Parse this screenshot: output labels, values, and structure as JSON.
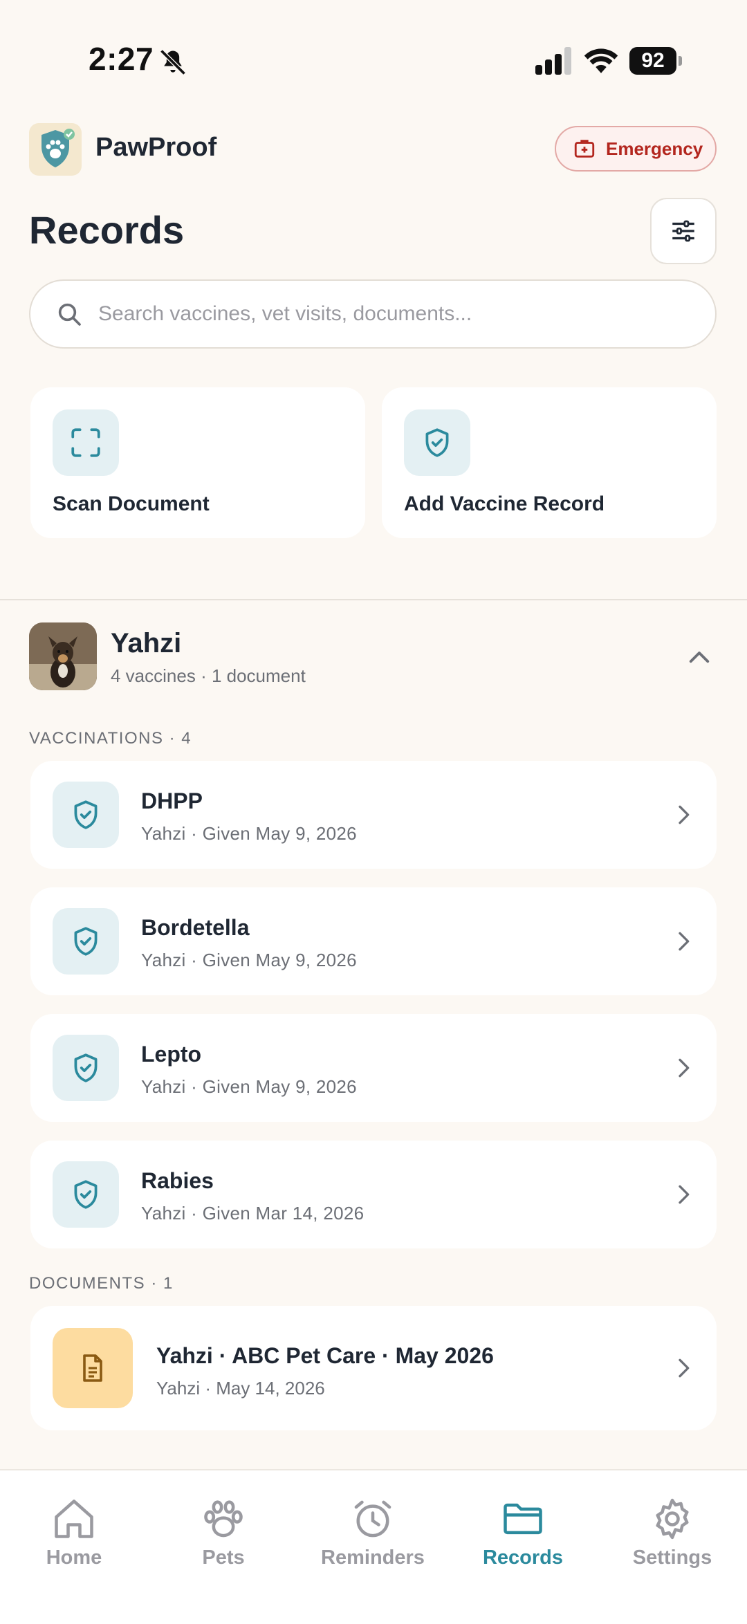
{
  "status_bar": {
    "time": "2:27",
    "battery": "92"
  },
  "header": {
    "app_name": "PawProof",
    "emergency_label": "Emergency",
    "page_title": "Records"
  },
  "search": {
    "placeholder": "Search vaccines, vet visits, documents..."
  },
  "actions": [
    {
      "label": "Scan Document",
      "icon": "scan-icon"
    },
    {
      "label": "Add Vaccine Record",
      "icon": "shield-check-icon"
    }
  ],
  "pet": {
    "name": "Yahzi",
    "summary": "4 vaccines · 1 document"
  },
  "vaccinations": {
    "section_label": "VACCINATIONS · 4",
    "items": [
      {
        "title": "DHPP",
        "subtitle": "Yahzi · Given May 9, 2026"
      },
      {
        "title": "Bordetella",
        "subtitle": "Yahzi · Given May 9, 2026"
      },
      {
        "title": "Lepto",
        "subtitle": "Yahzi · Given May 9, 2026"
      },
      {
        "title": "Rabies",
        "subtitle": "Yahzi · Given Mar 14, 2026"
      }
    ]
  },
  "documents": {
    "section_label": "DOCUMENTS · 1",
    "items": [
      {
        "title": "Yahzi · ABC Pet Care · May 2026",
        "subtitle": "Yahzi · May 14, 2026"
      }
    ]
  },
  "tabs": [
    {
      "label": "Home",
      "icon": "home-icon",
      "active": false
    },
    {
      "label": "Pets",
      "icon": "paw-icon",
      "active": false
    },
    {
      "label": "Reminders",
      "icon": "alarm-clock-icon",
      "active": false
    },
    {
      "label": "Records",
      "icon": "folder-icon",
      "active": true
    },
    {
      "label": "Settings",
      "icon": "gear-icon",
      "active": false
    }
  ],
  "colors": {
    "accent": "#2b8a9d",
    "emergency": "#b3261e",
    "background": "#fcf8f3",
    "doc_icon_bg": "#fddca0"
  }
}
